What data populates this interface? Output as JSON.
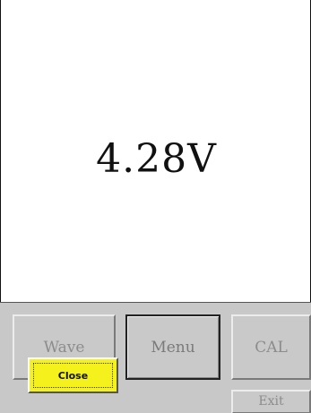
{
  "display": {
    "reading": "4.28V"
  },
  "buttons": {
    "wave": "Wave",
    "menu": "Menu",
    "cal": "CAL",
    "exit": "Exit"
  },
  "popup": {
    "close_label": "Close"
  },
  "colors": {
    "panel": "#c8c8c8",
    "close_button": "#f5f11d"
  }
}
